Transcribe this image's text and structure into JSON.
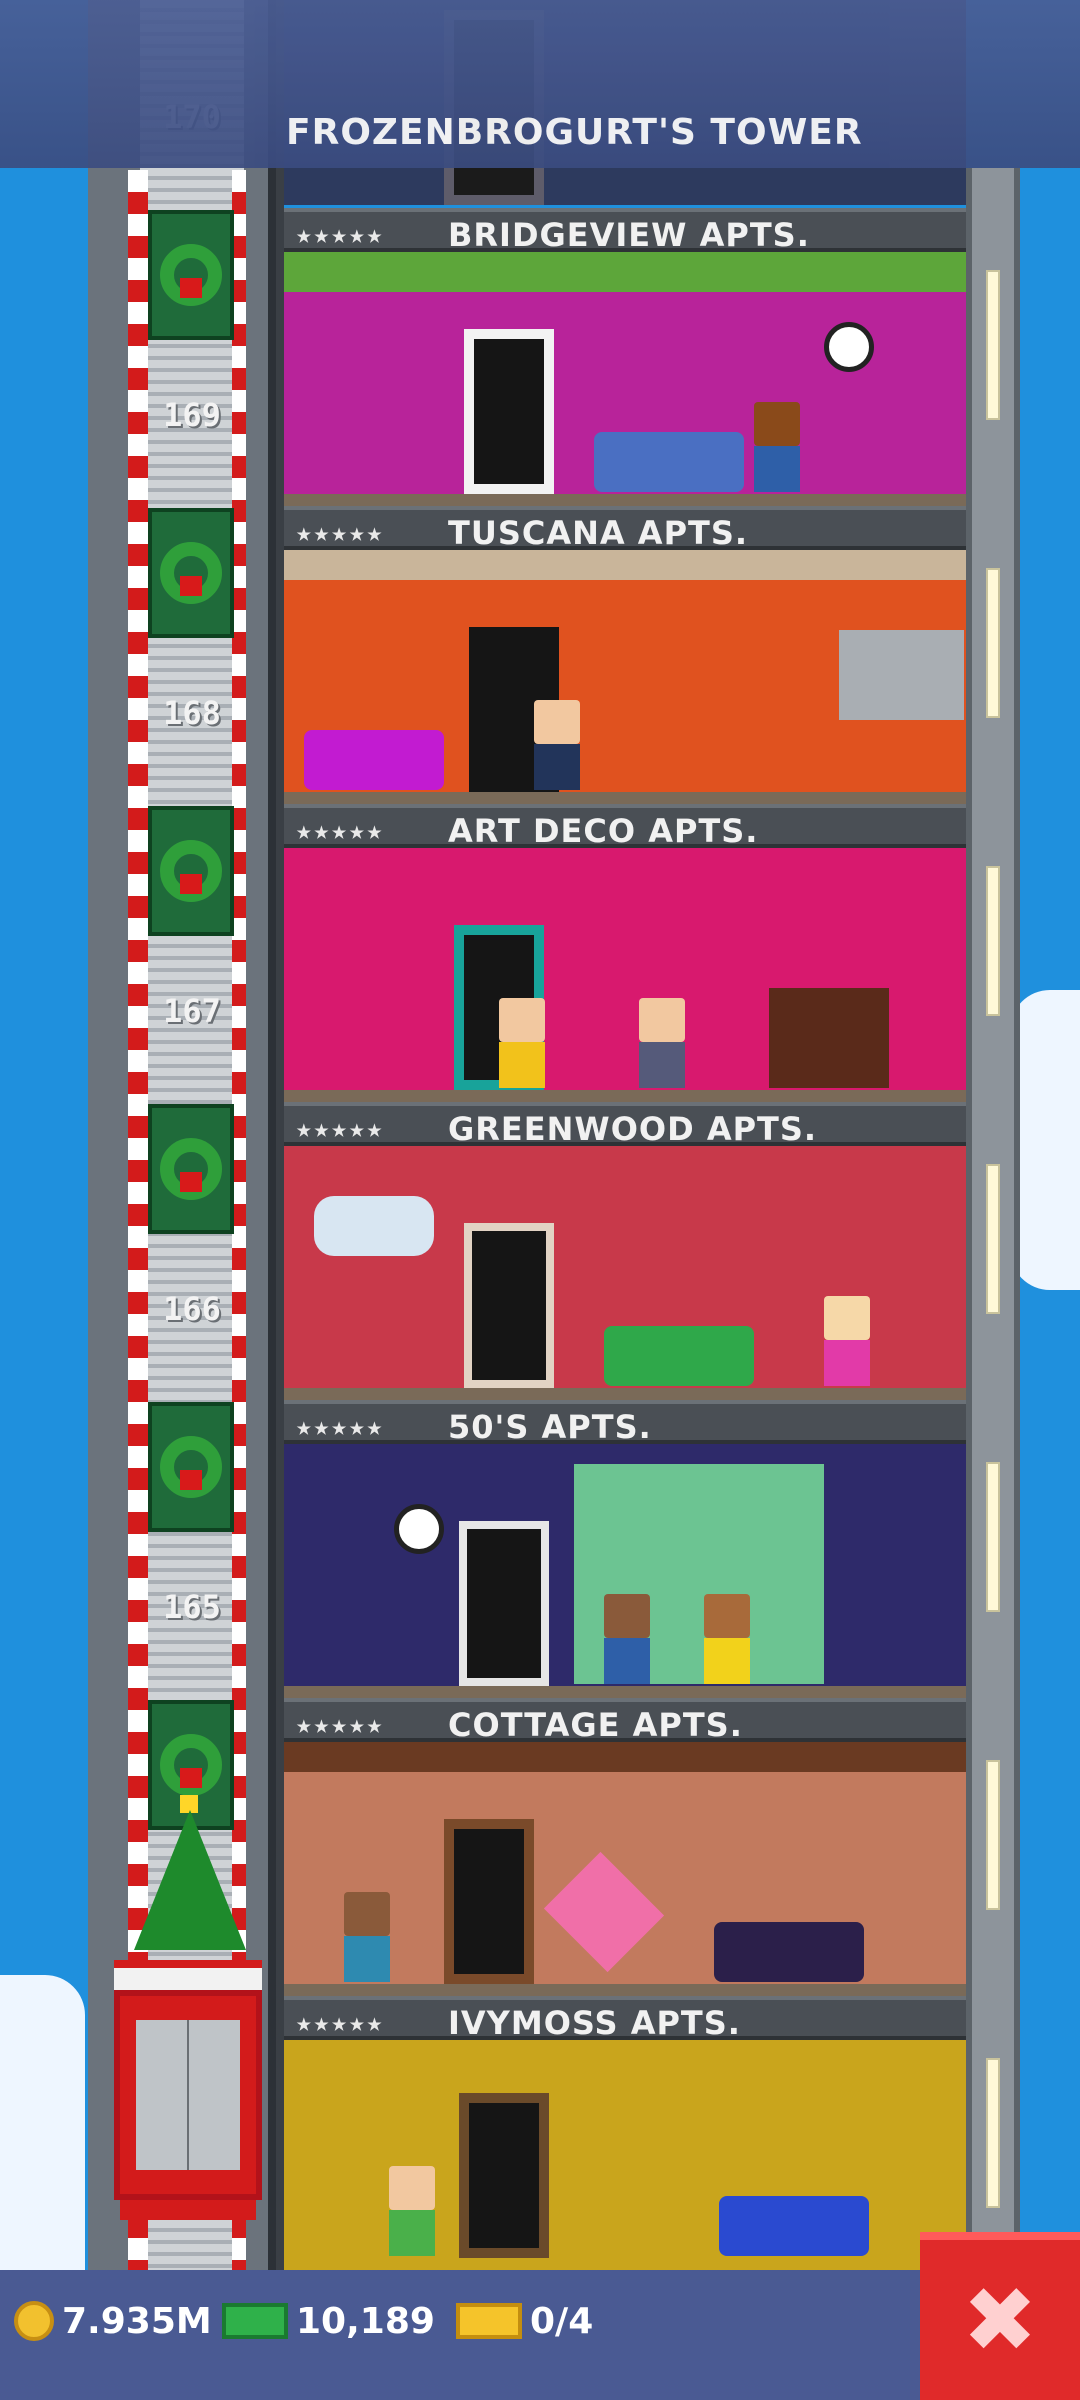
{
  "header": {
    "title": "FROZENBROGURT'S TOWER"
  },
  "elevator": {
    "floor_numbers": [
      "170",
      "169",
      "168",
      "167",
      "166",
      "165"
    ]
  },
  "floors": [
    {
      "name": "BRIDGEVIEW APTS.",
      "stars": "★★★★★",
      "wall": "#b8239a",
      "accent": "#5da63a"
    },
    {
      "name": "TUSCANA APTS.",
      "stars": "★★★★★",
      "wall": "#e0521f",
      "accent": "#c9b59a"
    },
    {
      "name": "ART DECO APTS.",
      "stars": "★★★★★",
      "wall": "#d8196e",
      "accent": "#18a39a"
    },
    {
      "name": "GREENWOOD APTS.",
      "stars": "★★★★★",
      "wall": "#c8394a",
      "accent": "#8a3a6a"
    },
    {
      "name": "50'S APTS.",
      "stars": "★★★★★",
      "wall": "#2e2a6a",
      "accent": "#6cc492"
    },
    {
      "name": "COTTAGE APTS.",
      "stars": "★★★★★",
      "wall": "#c27a5e",
      "accent": "#6a3a22"
    },
    {
      "name": "IVYMOSS APTS.",
      "stars": "★★★★★",
      "wall": "#c9a51c",
      "accent": "#6a4a2a"
    }
  ],
  "status": {
    "coins": "7.935M",
    "bux": "10,189",
    "tickets": "0/4"
  },
  "icons": {
    "coin": "coin-icon",
    "cash": "cash-icon",
    "bux": "golden-ticket-icon",
    "close": "close-icon"
  },
  "close_glyph": "✖"
}
